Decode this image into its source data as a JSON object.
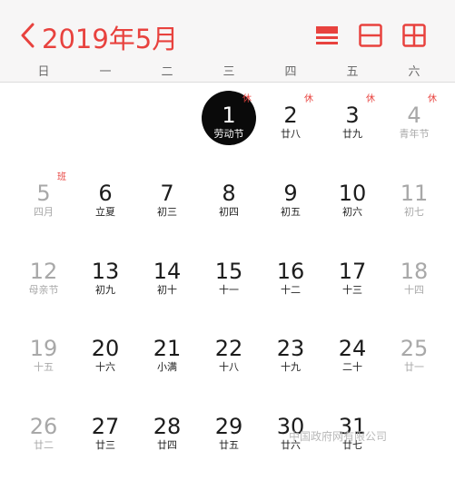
{
  "header": {
    "title": "2019年5月",
    "back_icon": "chevron-left-icon",
    "view_buttons": [
      "list-view-icon",
      "day-view-icon",
      "month-grid-icon"
    ],
    "accent_color": "#e8423e"
  },
  "weekdays": [
    "日",
    "一",
    "二",
    "三",
    "四",
    "五",
    "六"
  ],
  "days": [
    {
      "num": "1",
      "lunar": "劳动节",
      "badge": "休",
      "today": true
    },
    {
      "num": "2",
      "lunar": "廿八",
      "badge": "休"
    },
    {
      "num": "3",
      "lunar": "廿九",
      "badge": "休"
    },
    {
      "num": "4",
      "lunar": "青年节",
      "badge": "休"
    },
    {
      "num": "5",
      "lunar": "四月",
      "badge": "班"
    },
    {
      "num": "6",
      "lunar": "立夏"
    },
    {
      "num": "7",
      "lunar": "初三"
    },
    {
      "num": "8",
      "lunar": "初四"
    },
    {
      "num": "9",
      "lunar": "初五"
    },
    {
      "num": "10",
      "lunar": "初六"
    },
    {
      "num": "11",
      "lunar": "初七"
    },
    {
      "num": "12",
      "lunar": "母亲节"
    },
    {
      "num": "13",
      "lunar": "初九"
    },
    {
      "num": "14",
      "lunar": "初十"
    },
    {
      "num": "15",
      "lunar": "十一"
    },
    {
      "num": "16",
      "lunar": "十二"
    },
    {
      "num": "17",
      "lunar": "十三"
    },
    {
      "num": "18",
      "lunar": "十四"
    },
    {
      "num": "19",
      "lunar": "十五"
    },
    {
      "num": "20",
      "lunar": "十六"
    },
    {
      "num": "21",
      "lunar": "小满"
    },
    {
      "num": "22",
      "lunar": "十八"
    },
    {
      "num": "23",
      "lunar": "十九"
    },
    {
      "num": "24",
      "lunar": "二十"
    },
    {
      "num": "25",
      "lunar": "廿一"
    },
    {
      "num": "26",
      "lunar": "廿二"
    },
    {
      "num": "27",
      "lunar": "廿三"
    },
    {
      "num": "28",
      "lunar": "廿四"
    },
    {
      "num": "29",
      "lunar": "廿五"
    },
    {
      "num": "30",
      "lunar": "廿六"
    },
    {
      "num": "31",
      "lunar": "廿七"
    }
  ],
  "watermark": "中国政府网有限公司"
}
